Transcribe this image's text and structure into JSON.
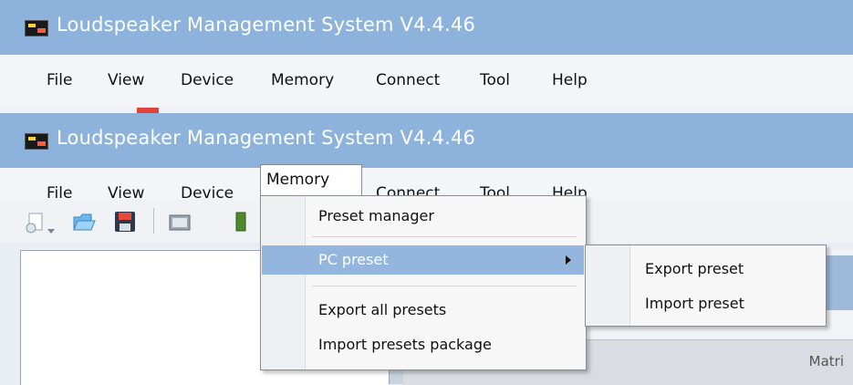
{
  "window_back": {
    "title": "Loudspeaker Management System V4.4.46",
    "menu": [
      "File",
      "View",
      "Device",
      "Memory",
      "Connect",
      "Tool",
      "Help"
    ]
  },
  "window_front": {
    "title": "Loudspeaker Management System V4.4.46",
    "menu": [
      "File",
      "View",
      "Device",
      "Memory",
      "Connect",
      "Tool",
      "Help"
    ],
    "active_menu": "Memory"
  },
  "memory_menu": {
    "items": [
      "Preset manager",
      "PC preset",
      "Export all presets",
      "Import presets package"
    ],
    "highlighted": "PC preset"
  },
  "pc_preset_submenu": {
    "items": [
      "Export preset",
      "Import preset"
    ]
  },
  "right_panel": {
    "header_text": "Matri"
  },
  "colors": {
    "titlebar": "#8db3dc",
    "highlight": "#93b5de",
    "menu_bg": "#f7f7f7"
  }
}
